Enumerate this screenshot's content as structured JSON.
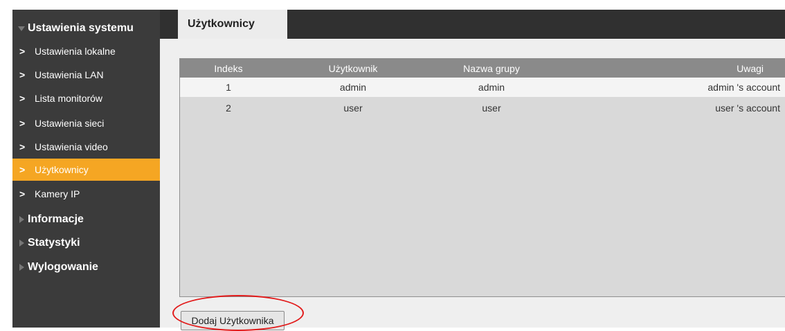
{
  "sidebar": {
    "section_title": "Ustawienia systemu",
    "items": [
      {
        "label": "Ustawienia lokalne",
        "active": false
      },
      {
        "label": "Ustawienia LAN",
        "active": false
      },
      {
        "label": "Lista monitorów",
        "active": false
      },
      {
        "label": "Ustawienia sieci",
        "active": false
      },
      {
        "label": "Ustawienia video",
        "active": false
      },
      {
        "label": "Użytkownicy",
        "active": true
      },
      {
        "label": "Kamery IP",
        "active": false
      }
    ],
    "sections": [
      {
        "label": "Informacje"
      },
      {
        "label": "Statystyki"
      },
      {
        "label": "Wylogowanie"
      }
    ],
    "chevron_glyph": ">"
  },
  "tab": {
    "label": "Użytkownicy"
  },
  "table": {
    "headers": [
      "Indeks",
      "Użytkownik",
      "Nazwa grupy",
      "Uwagi"
    ],
    "rows": [
      [
        "1",
        "admin",
        "admin",
        "admin 's account"
      ],
      [
        "2",
        "user",
        "user",
        "user 's account"
      ]
    ]
  },
  "add_button": {
    "label": "Dodaj Użytkownika"
  },
  "colors": {
    "accent": "#f5a623",
    "sidebar": "#3b3b3b",
    "topbar": "#303030",
    "highlight": "#e21b1b"
  }
}
